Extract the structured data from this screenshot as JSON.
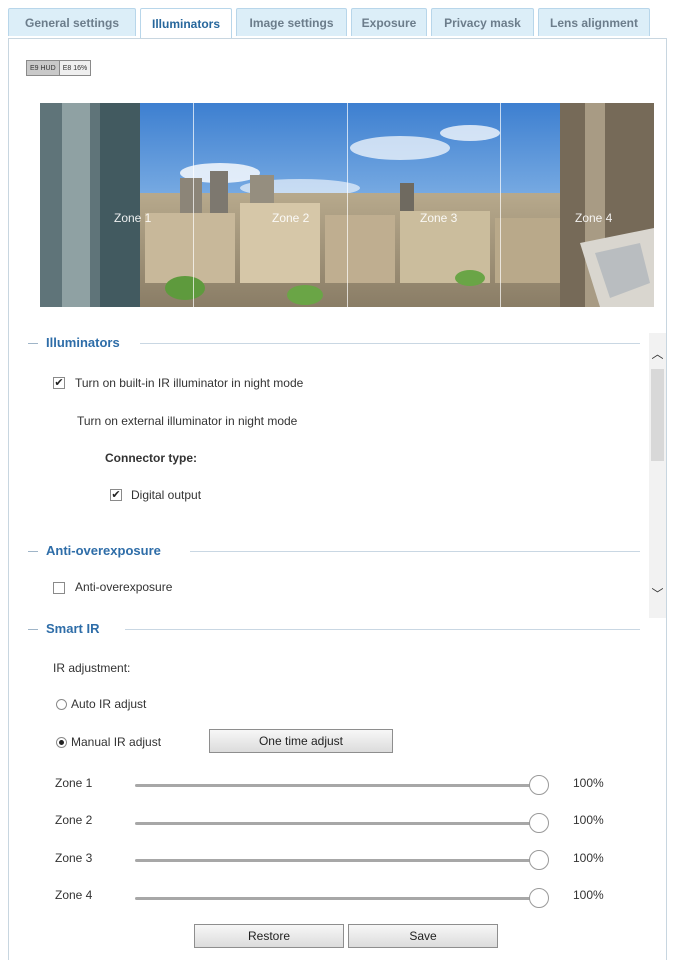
{
  "tabs": [
    {
      "label": "General settings"
    },
    {
      "label": "Illuminators"
    },
    {
      "label": "Image settings"
    },
    {
      "label": "Exposure"
    },
    {
      "label": "Privacy mask"
    },
    {
      "label": "Lens alignment"
    }
  ],
  "view_badge": {
    "left": "E9 HUD",
    "right": "E8 16%"
  },
  "preview": {
    "zones": [
      "Zone 1",
      "Zone 2",
      "Zone 3",
      "Zone 4"
    ]
  },
  "illuminators": {
    "title": "Illuminators",
    "builtin_ir": {
      "label": "Turn on built-in IR illuminator in night mode",
      "checked": true
    },
    "external": {
      "label": "Turn on external illuminator in night mode"
    },
    "connector_type": {
      "label": "Connector type:"
    },
    "digital_output": {
      "label": "Digital output",
      "checked": true
    }
  },
  "anti_overexposure": {
    "title": "Anti-overexposure",
    "checkbox": {
      "label": "Anti-overexposure",
      "checked": false
    }
  },
  "smart_ir": {
    "title": "Smart IR",
    "ir_adjustment_label": "IR adjustment:",
    "auto_option": {
      "label": "Auto IR adjust",
      "selected": false
    },
    "manual_option": {
      "label": "Manual IR adjust",
      "selected": true
    },
    "one_time_button": "One time adjust",
    "zones": [
      {
        "label": "Zone 1",
        "value": "100%"
      },
      {
        "label": "Zone 2",
        "value": "100%"
      },
      {
        "label": "Zone 3",
        "value": "100%"
      },
      {
        "label": "Zone 4",
        "value": "100%"
      }
    ]
  },
  "footer": {
    "restore_label": "Restore",
    "save_label": "Save"
  },
  "colors": {
    "accent": "#2e6da8",
    "tab_bg": "#dceef8"
  }
}
